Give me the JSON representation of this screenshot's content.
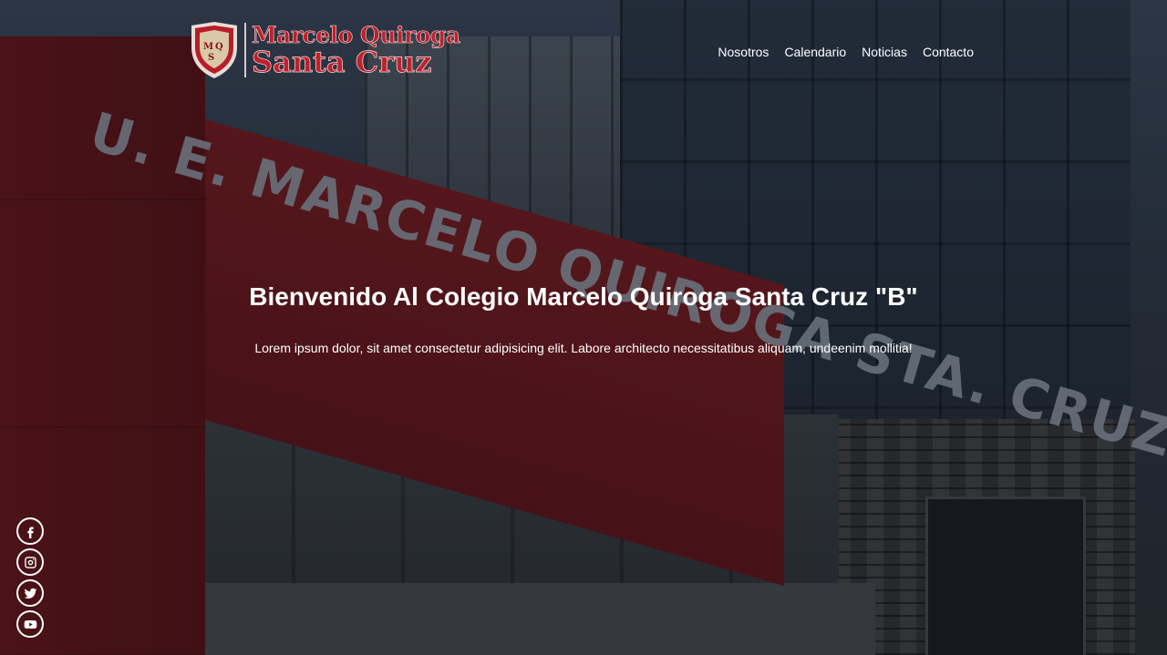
{
  "brand": {
    "line1": "Marcelo Quiroga",
    "line2": "Santa Cruz",
    "shield_monogram": "MQSC",
    "shield_color": "#b81d2a"
  },
  "background": {
    "sign_text": "U. E. MARCELO QUIROGA STA. CRUZ \"B\""
  },
  "nav": {
    "items": [
      {
        "label": "Nosotros"
      },
      {
        "label": "Calendario"
      },
      {
        "label": "Noticias"
      },
      {
        "label": "Contacto"
      }
    ]
  },
  "hero": {
    "title": "Bienvenido Al Colegio Marcelo Quiroga Santa Cruz \"B\"",
    "subtitle": "Lorem ipsum dolor, sit amet consectetur adipisicing elit. Labore architecto necessitatibus aliquam, undeenim mollitia!"
  },
  "social": {
    "items": [
      {
        "icon": "facebook-icon"
      },
      {
        "icon": "instagram-icon"
      },
      {
        "icon": "twitter-icon"
      },
      {
        "icon": "youtube-icon"
      }
    ]
  },
  "colors": {
    "brand_red": "#c0202a",
    "text": "#ffffff"
  }
}
